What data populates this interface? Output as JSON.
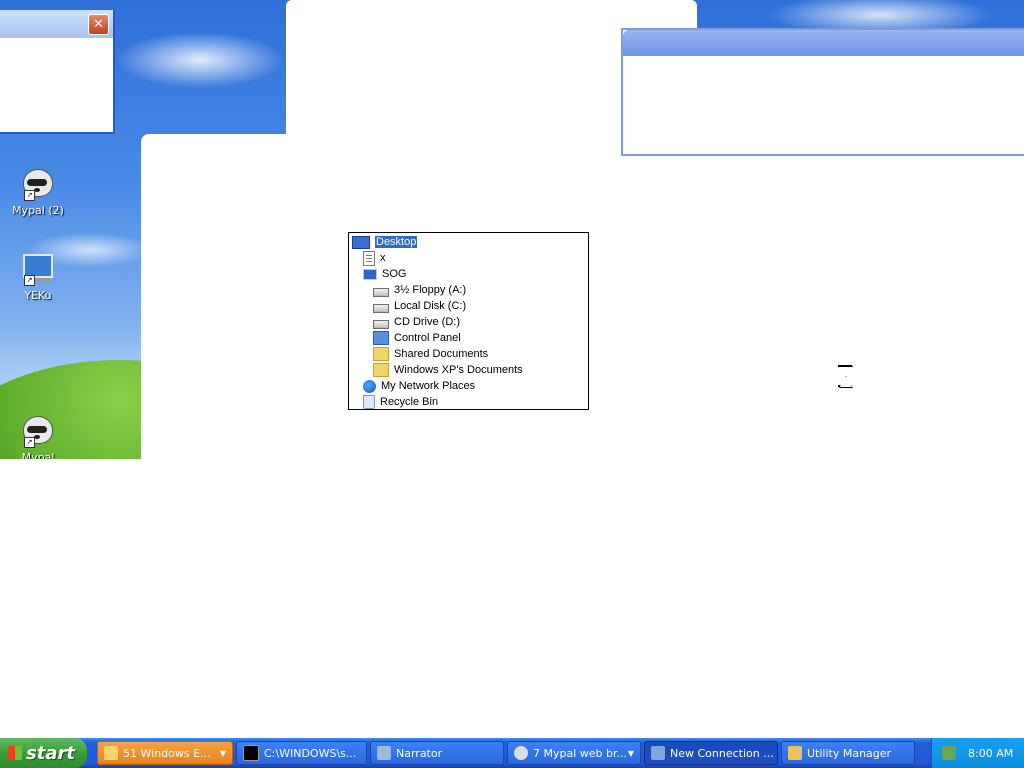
{
  "desktop": {
    "icons": [
      {
        "label": "Mypal (2)",
        "icon": "raccoon-icon"
      },
      {
        "label": "YEKu",
        "icon": "computer-icon"
      },
      {
        "label": "Mypal",
        "icon": "raccoon-icon"
      }
    ]
  },
  "windows": {
    "small_close": "✕"
  },
  "tree": {
    "items": [
      {
        "label": "Desktop",
        "icon": "desktop-icon",
        "selected": true
      },
      {
        "label": "x",
        "icon": "document-icon"
      },
      {
        "label": "SOG",
        "icon": "computer-icon"
      },
      {
        "label": "3½ Floppy (A:)",
        "icon": "floppy-drive-icon"
      },
      {
        "label": "Local Disk (C:)",
        "icon": "hard-disk-icon"
      },
      {
        "label": "CD Drive (D:)",
        "icon": "cd-drive-icon"
      },
      {
        "label": "Control Panel",
        "icon": "control-panel-icon"
      },
      {
        "label": "Shared Documents",
        "icon": "folder-icon"
      },
      {
        "label": "Windows XP's Documents",
        "icon": "folder-icon"
      },
      {
        "label": "My Network Places",
        "icon": "network-icon"
      },
      {
        "label": "Recycle Bin",
        "icon": "recycle-bin-icon"
      }
    ]
  },
  "taskbar": {
    "start_label": "start",
    "tasks": [
      {
        "label": "51 Windows E...",
        "state": "flashing"
      },
      {
        "label": "C:\\WINDOWS\\s...",
        "state": "normal"
      },
      {
        "label": "Narrator",
        "state": "normal"
      },
      {
        "label": "7 Mypal web br...",
        "state": "normal"
      },
      {
        "label": "New Connection ...",
        "state": "active"
      },
      {
        "label": "Utility Manager",
        "state": "normal"
      }
    ],
    "clock": "8:00 AM"
  },
  "colors": {
    "taskbar_blue": "#245edb",
    "start_green": "#3a9e3a",
    "selection_blue": "#316ac5",
    "flash_orange": "#e6821e"
  }
}
